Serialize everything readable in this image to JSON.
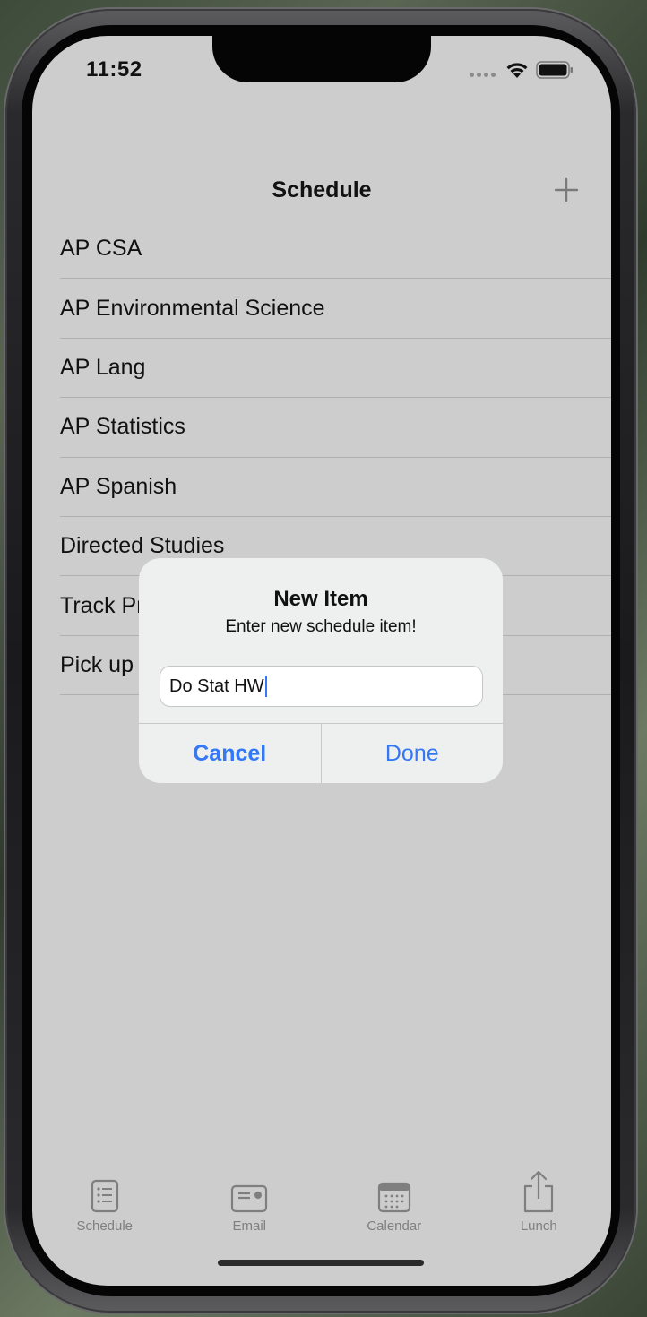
{
  "status_bar": {
    "time": "11:52",
    "icons": [
      "signal-icon",
      "wifi-icon",
      "battery-icon"
    ]
  },
  "nav": {
    "title": "Schedule",
    "add_icon": "plus-icon"
  },
  "schedule": {
    "items": [
      {
        "label": "AP CSA"
      },
      {
        "label": "AP Environmental Science"
      },
      {
        "label": "AP Lang"
      },
      {
        "label": "AP Statistics"
      },
      {
        "label": "AP Spanish"
      },
      {
        "label": "Directed Studies"
      },
      {
        "label": "Track Pr"
      },
      {
        "label": "Pick up"
      }
    ]
  },
  "dialog": {
    "title": "New Item",
    "message": "Enter new schedule item!",
    "input_value": "Do Stat HW",
    "cancel_label": "Cancel",
    "done_label": "Done"
  },
  "tabs": [
    {
      "label": "Schedule",
      "icon": "schedule-icon"
    },
    {
      "label": "Email",
      "icon": "email-icon"
    },
    {
      "label": "Calendar",
      "icon": "calendar-icon"
    },
    {
      "label": "Lunch",
      "icon": "share-icon"
    }
  ],
  "colors": {
    "accent": "#3478f6",
    "background": "#cdcdcd",
    "dialog_background": "#eeefef",
    "tab_inactive": "#7f7f7f"
  }
}
